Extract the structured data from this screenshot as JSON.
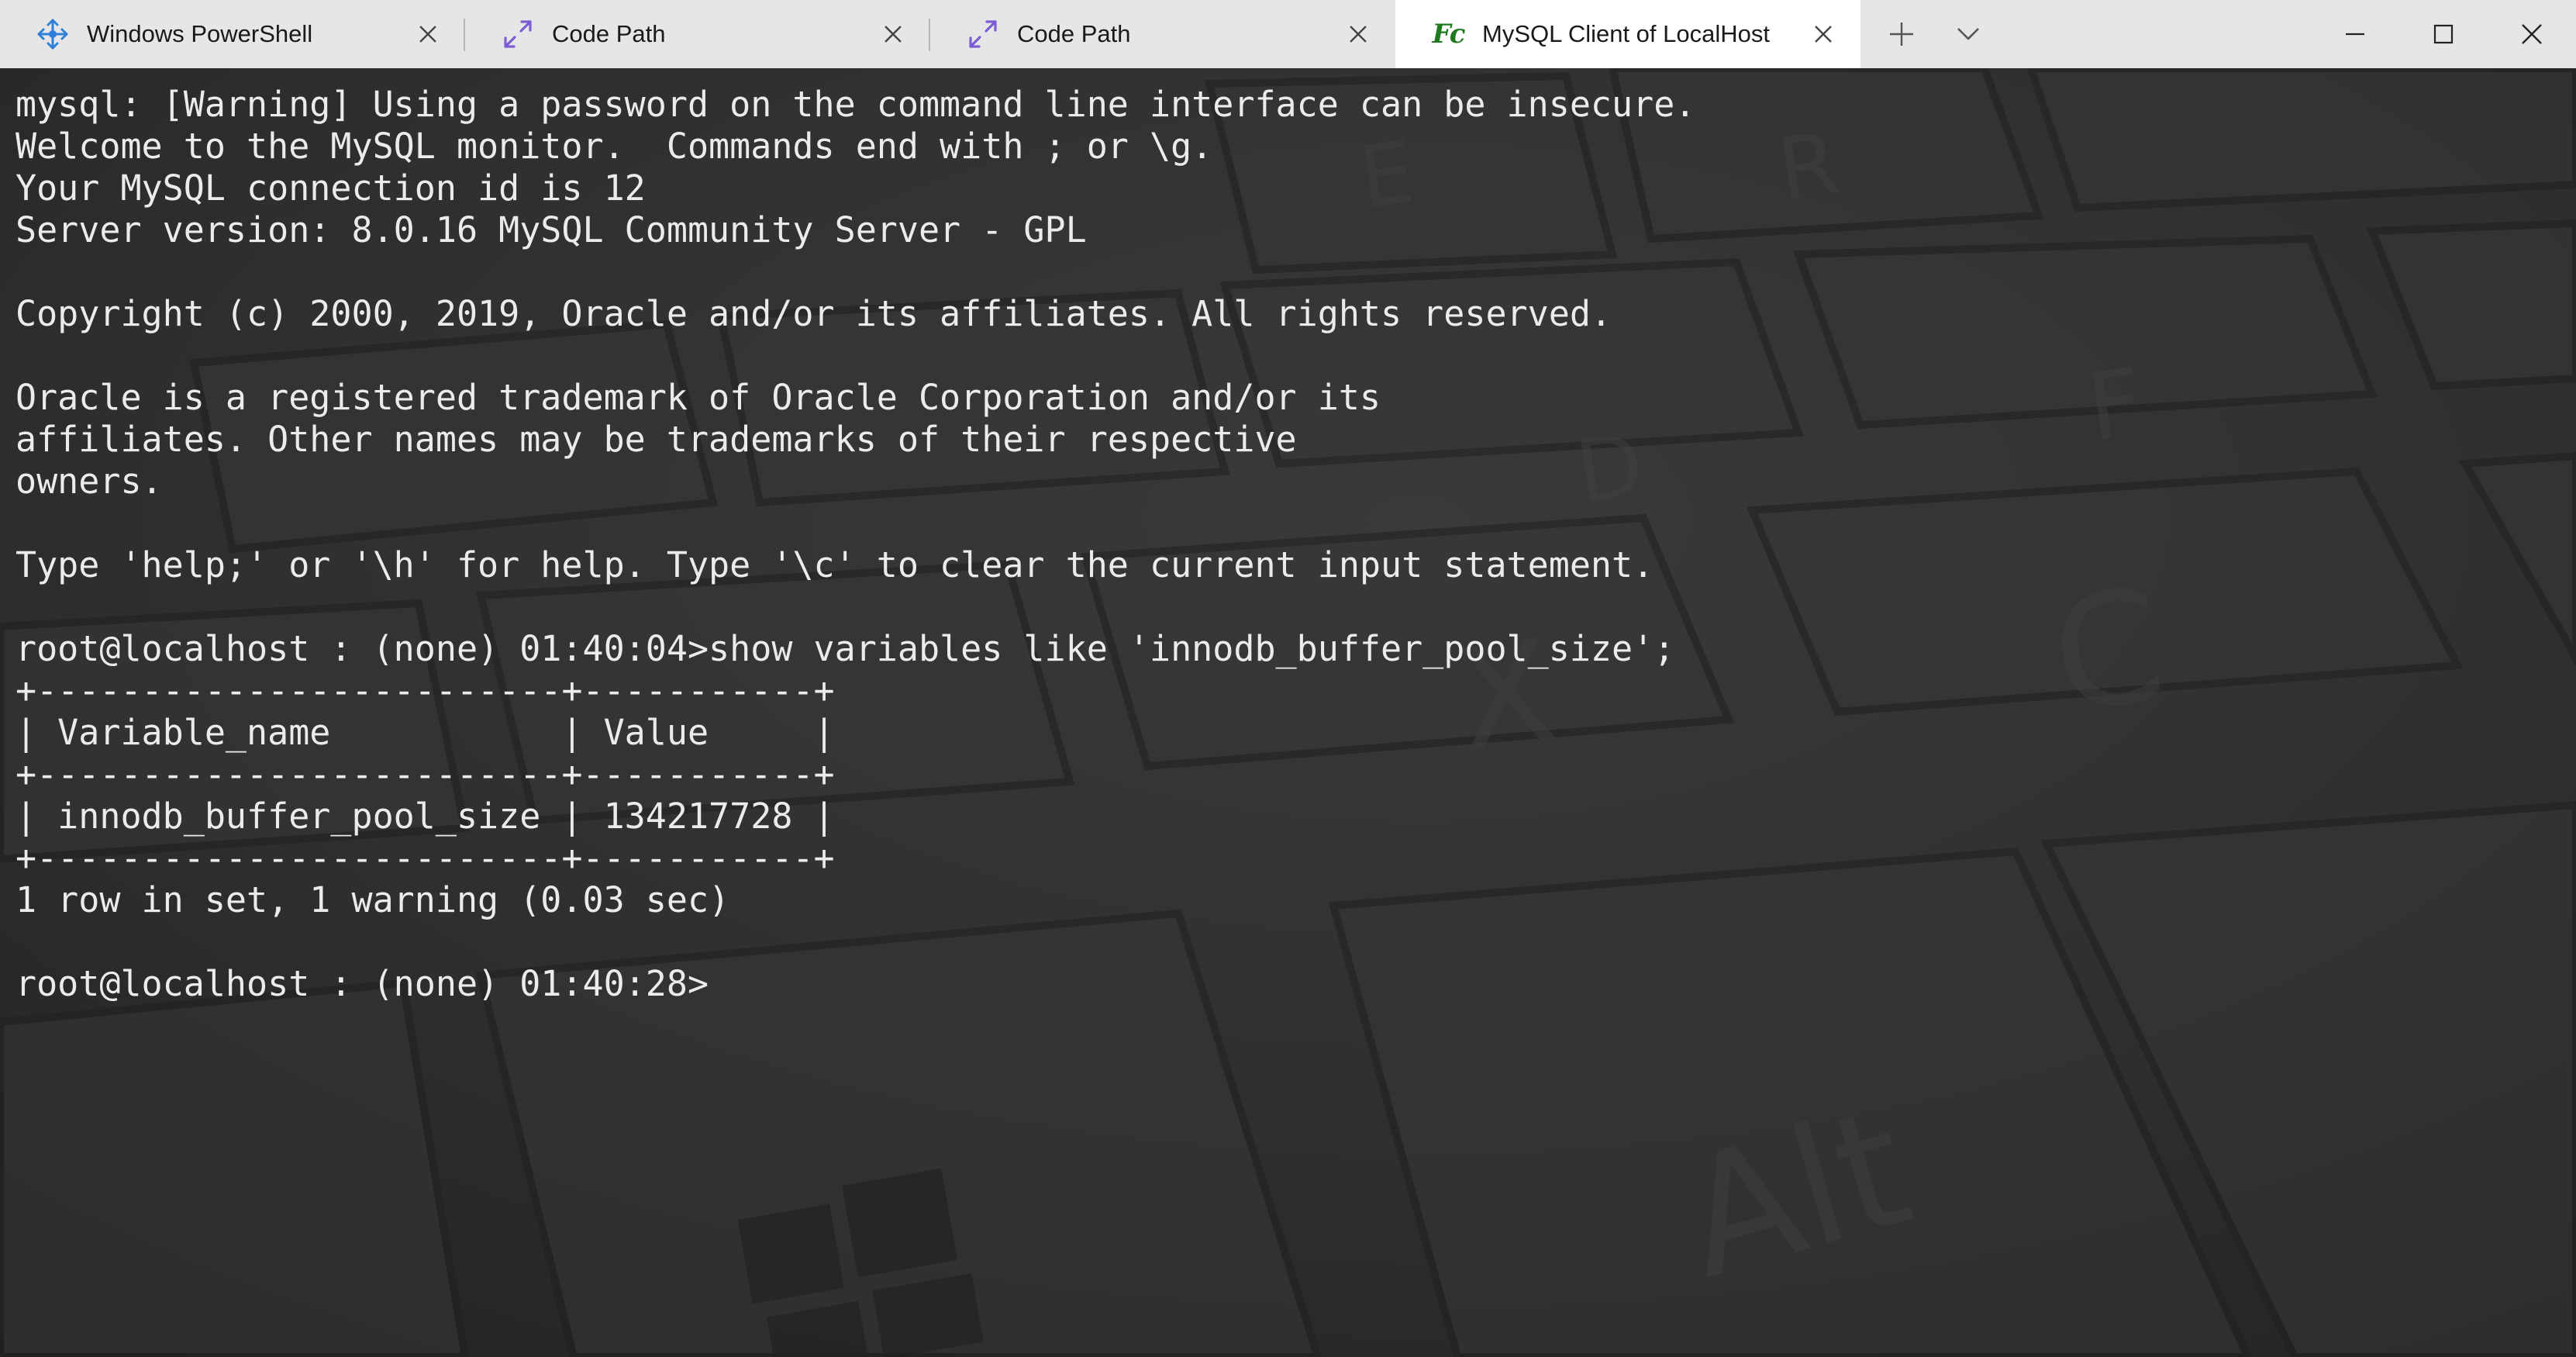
{
  "tabs": [
    {
      "label": "Windows PowerShell",
      "icon": "powershell-move-icon",
      "active": false
    },
    {
      "label": "Code Path",
      "icon": "expand-arrows-icon",
      "active": false
    },
    {
      "label": "Code Path",
      "icon": "expand-arrows-icon",
      "active": false
    },
    {
      "label": "MySQL Client of LocalHost",
      "icon": "fc-icon",
      "icon_text": "Fc",
      "active": true
    }
  ],
  "tab_actions": {
    "new_tab_icon": "plus-icon",
    "dropdown_icon": "chevron-down-icon"
  },
  "window_controls": [
    "minimize-icon",
    "maximize-icon",
    "close-icon"
  ],
  "terminal": {
    "lines": [
      "mysql: [Warning] Using a password on the command line interface can be insecure.",
      "Welcome to the MySQL monitor.  Commands end with ; or \\g.",
      "Your MySQL connection id is 12",
      "Server version: 8.0.16 MySQL Community Server - GPL",
      "",
      "Copyright (c) 2000, 2019, Oracle and/or its affiliates. All rights reserved.",
      "",
      "Oracle is a registered trademark of Oracle Corporation and/or its",
      "affiliates. Other names may be trademarks of their respective",
      "owners.",
      "",
      "Type 'help;' or '\\h' for help. Type '\\c' to clear the current input statement.",
      "",
      "root@localhost : (none) 01:40:04>show variables like 'innodb_buffer_pool_size';",
      "+-------------------------+-----------+",
      "| Variable_name           | Value     |",
      "+-------------------------+-----------+",
      "| innodb_buffer_pool_size | 134217728 |",
      "+-------------------------+-----------+",
      "1 row in set, 1 warning (0.03 sec)",
      "",
      "root@localhost : (none) 01:40:28>"
    ]
  },
  "colors": {
    "titlebar": "#e6e6e6",
    "active_tab": "#ffffff",
    "terminal_text": "#ebebeb",
    "terminal_bg": "#3a3a3a",
    "code_path_icon": "#7b5cd6",
    "powershell_icon": "#2f7ed8",
    "fc_icon": "#1f7a1f"
  }
}
